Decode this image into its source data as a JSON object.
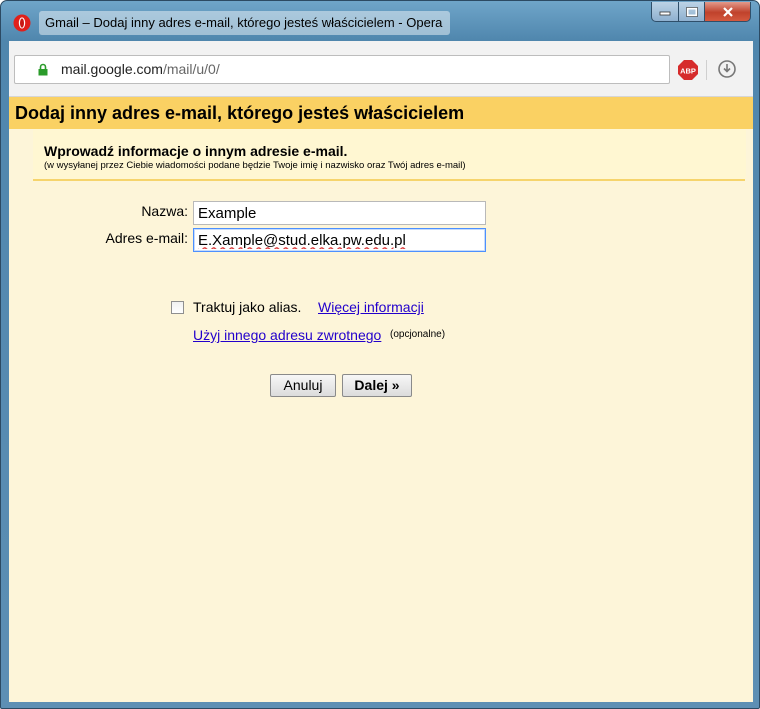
{
  "window": {
    "title": "Gmail – Dodaj inny adres e-mail, którego jesteś właścicielem - Opera",
    "controls": [
      "minimize-icon",
      "maximize-icon",
      "close-icon"
    ]
  },
  "browser": {
    "url_host": "mail.google.com",
    "url_path": "/mail/u/0/",
    "extension_label": "ABP"
  },
  "dialog": {
    "header": "Dodaj inny adres e-mail, którego jesteś właścicielem",
    "intro_title": "Wprowadź informacje o innym adresie e-mail.",
    "intro_subtitle": "(w wysyłanej przez Ciebie wiadomości podane będzie Twoje imię i nazwisko oraz Twój adres e-mail)",
    "name_label": "Nazwa:",
    "name_value": "Example",
    "email_label": "Adres e-mail:",
    "email_value": "E.Xample@stud.elka.pw.edu.pl",
    "alias_label": "Traktuj jako alias.",
    "alias_checked": false,
    "alias_link": "Więcej informacji",
    "return_link": "Użyj innego adresu zwrotnego",
    "return_optional": "(opcjonalne)",
    "cancel_button": "Anuluj",
    "next_button": "Dalej »"
  },
  "colors": {
    "header_bg": "#fad163",
    "page_bg": "#fdf5d9",
    "link": "#2200cc"
  }
}
